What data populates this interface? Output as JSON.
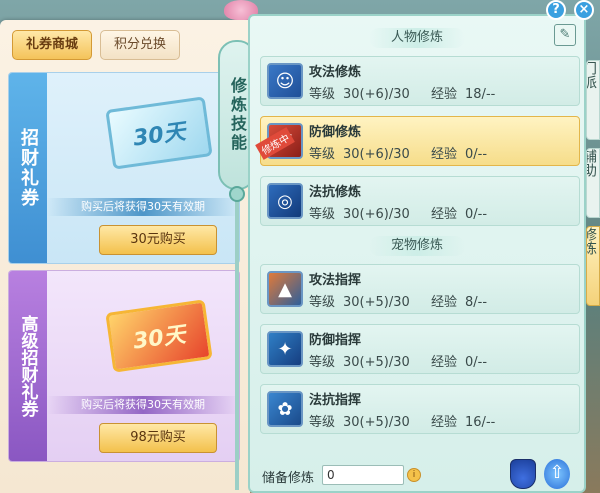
{
  "window": {
    "help_label": "?",
    "close_label": "×"
  },
  "shop": {
    "tabs": [
      {
        "label": "礼券商城"
      },
      {
        "label": "积分兑换"
      }
    ],
    "cards": [
      {
        "strip": "招财礼券",
        "ticket": "30天",
        "desc": "购买后将获得30天有效期",
        "buy": "30元购买"
      },
      {
        "strip": "高级招财礼券",
        "ticket": "30天",
        "desc": "购买后将获得30天有效期",
        "buy": "98元购买"
      }
    ]
  },
  "skill_tab": {
    "label": "修炼技能"
  },
  "panel": {
    "section_person": "人物修炼",
    "section_pet": "宠物修炼",
    "level_label": "等级",
    "exp_label": "经验",
    "tag_label": "修炼中",
    "person_rows": [
      {
        "name": "攻法修炼",
        "level": "30(+6)/30",
        "exp": "18/--",
        "selected": false,
        "icon": "attack-magic-icon"
      },
      {
        "name": "防御修炼",
        "level": "30(+6)/30",
        "exp": "0/--",
        "selected": true,
        "icon": "defense-icon"
      },
      {
        "name": "法抗修炼",
        "level": "30(+6)/30",
        "exp": "0/--",
        "selected": false,
        "icon": "magic-resist-icon"
      }
    ],
    "pet_rows": [
      {
        "name": "攻法指挥",
        "level": "30(+5)/30",
        "exp": "8/--",
        "icon": "pet-attack-icon"
      },
      {
        "name": "防御指挥",
        "level": "30(+5)/30",
        "exp": "0/--",
        "icon": "pet-defense-icon"
      },
      {
        "name": "法抗指挥",
        "level": "30(+5)/30",
        "exp": "16/--",
        "icon": "pet-resist-icon"
      }
    ],
    "footer": {
      "label": "储备修炼",
      "value": "0"
    }
  },
  "right_tabs": [
    {
      "label": "门派"
    },
    {
      "label": "辅助"
    },
    {
      "label": "修炼"
    }
  ]
}
